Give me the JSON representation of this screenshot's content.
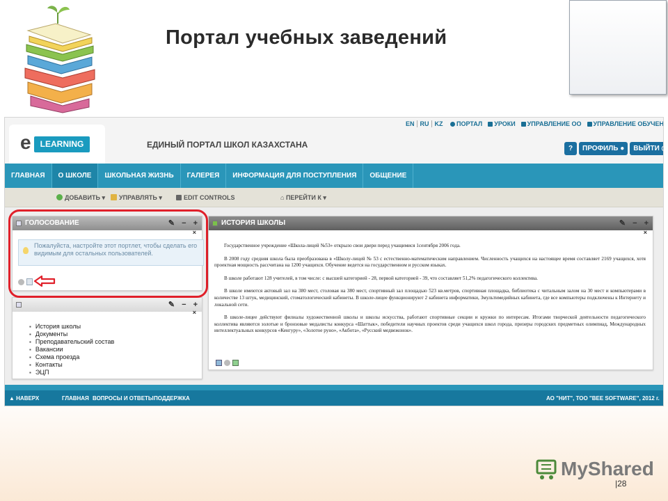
{
  "slide": {
    "title": "Портал учебных заведений",
    "page_number": "28",
    "logo_text": "MyShared"
  },
  "header": {
    "logo_letter": "e",
    "logo_badge": "LEARNING",
    "portal_name": "ЕДИНЫЙ ПОРТАЛ ШКОЛ КАЗАХСТАНА",
    "languages": [
      "EN",
      "RU",
      "KZ"
    ],
    "top_links": [
      "ПОРТАЛ",
      "УРОКИ",
      "УПРАВЛЕНИЕ ОО",
      "УПРАВЛЕНИЕ ОБУЧЕНИЕМ"
    ],
    "help_label": "?",
    "profile_label": "ПРОФИЛЬ",
    "logout_label": "ВЫЙТИ"
  },
  "nav": {
    "items": [
      "ГЛАВНАЯ",
      "О ШКОЛЕ",
      "ШКОЛЬНАЯ ЖИЗНЬ",
      "ГАЛЕРЕЯ",
      "ИНФОРМАЦИЯ ДЛЯ ПОСТУПЛЕНИЯ",
      "ОБЩЕНИЕ"
    ],
    "active_index": 1
  },
  "controls": {
    "add": "ДОБАВИТЬ",
    "manage": "УПРАВЛЯТЬ",
    "edit": "EDIT CONTROLS",
    "goto": "ПЕРЕЙТИ К"
  },
  "vote_portlet": {
    "title": "ГОЛОСОВАНИЕ",
    "message": "Пожалуйста, настройте этот портлет, чтобы сделать его видимым для остальных пользователей."
  },
  "links_portlet": {
    "items": [
      "История школы",
      "Документы",
      "Преподавательский состав",
      "Вакансии",
      "Схема проезда",
      "Контакты",
      "ЭЦП"
    ]
  },
  "history_portlet": {
    "title": "ИСТОРИЯ ШКОЛЫ",
    "paragraphs": [
      "Государственное учреждение «Школа-лицей №53» открыло свои двери перед учащимися 1сентября 2006 года.",
      "В 2008 году средняя школа была преобразована в «Школу-лицей № 53 с естественно-математическим направлением. Численность учащихся на настоящее время составляет 2169 учащихся, хотя проектная мощность рассчитана на 1200 учащихся. Обучение ведется на государственном и русском языках.",
      "В школе работают 128 учителей, в том числе: с высшей категорией - 28, первой категорией - 39, что составляет 51,2% педагогического коллектива.",
      "В школе имеются актовый зал на 380 мест, столовая на 380 мест, спортивный зал площадью 523 кв.метров, спортивная площадка, библиотека с читальным залом на 30 мест и компьютерами в количестве 13 штук, медицинский, стоматологический кабинеты. В школе-лицее функционируют 2 кабинета информатики, 3мультимедийных кабинета, где все компьютеры подключены к Интернету и локальной сети.",
      "В школе-лицее действуют филиалы художественной школы и школы искусства, работают спортивные секции и кружки по интересам. Итогами творческой деятельности педагогического коллектива являются золотые и бронзовые медалисты конкурса «Шаттык», победители научных проектов среди учащихся школ города, призеры городских предметных олимпиад, Международных интеллектуальных конкурсов «Кенгуру», «Золотое руно», «Акбота», «Русский медвежонок»."
    ]
  },
  "portlet_tools": {
    "wrench": "✎",
    "minimize": "−",
    "add": "+",
    "close": "×"
  },
  "footer": {
    "top": "НАВЕРХ",
    "links": [
      "ГЛАВНАЯ",
      "ВОПРОСЫ И ОТВЕТЫ",
      "ПОДДЕРЖКА"
    ],
    "copyright": "АО \"НИТ\", ТОО \"BEE SOFTWARE\", 2012 г."
  }
}
